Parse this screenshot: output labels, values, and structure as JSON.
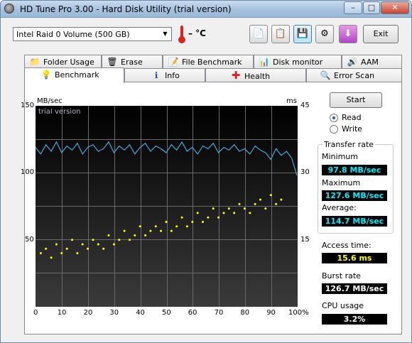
{
  "window": {
    "title": "HD Tune Pro 3.00 - Hard Disk Utility (trial version)"
  },
  "caption_buttons": {
    "minimize": "–",
    "maximize": "□",
    "close": "✕"
  },
  "toolbar": {
    "drive": "Intel   Raid 0 Volume (500 GB)",
    "temperature": "– °C",
    "exit_label": "Exit"
  },
  "tabs_top": [
    {
      "label": "Folder Usage",
      "icon": "folder-icon"
    },
    {
      "label": "Erase",
      "icon": "trash-icon"
    },
    {
      "label": "File Benchmark",
      "icon": "file-benchmark-icon"
    },
    {
      "label": "Disk monitor",
      "icon": "monitor-icon"
    },
    {
      "label": "AAM",
      "icon": "speaker-icon"
    }
  ],
  "tabs_bottom": [
    {
      "label": "Benchmark",
      "icon": "lightbulb-icon",
      "selected": true
    },
    {
      "label": "Info",
      "icon": "info-icon"
    },
    {
      "label": "Health",
      "icon": "health-cross-icon"
    },
    {
      "label": "Error Scan",
      "icon": "magnifier-icon"
    }
  ],
  "benchmark": {
    "start_label": "Start",
    "mode": {
      "read_label": "Read",
      "write_label": "Write",
      "selected": "read"
    },
    "transfer_rate_title": "Transfer rate",
    "minimum_label": "Minimum",
    "minimum_value": "97.8 MB/sec",
    "maximum_label": "Maximum",
    "maximum_value": "127.6 MB/sec",
    "average_label": "Average:",
    "average_value": "114.7 MB/sec",
    "access_time_label": "Access time:",
    "access_time_value": "15.6 ms",
    "burst_rate_label": "Burst rate",
    "burst_rate_value": "126.7 MB/sec",
    "cpu_usage_label": "CPU usage",
    "cpu_usage_value": "3.2%"
  },
  "chart_data": {
    "type": "line",
    "watermark": "trial version",
    "ylabel_left": "MB/sec",
    "ylabel_right": "ms",
    "yticks_left": [
      "150",
      "100",
      "50"
    ],
    "yticks_right": [
      "45",
      "30",
      "15"
    ],
    "xticks": [
      "0",
      "10",
      "20",
      "30",
      "40",
      "50",
      "60",
      "70",
      "80",
      "90",
      "100%"
    ],
    "xlim": [
      0,
      100
    ],
    "ylim_left": [
      0,
      150
    ],
    "ylim_right": [
      0,
      45
    ],
    "grid": true,
    "series": [
      {
        "kind": "transfer-rate-line",
        "color": "#3fa9e0",
        "axis": "left",
        "x": [
          0,
          2,
          4,
          6,
          8,
          10,
          12,
          14,
          16,
          18,
          20,
          22,
          24,
          26,
          28,
          30,
          32,
          34,
          36,
          38,
          40,
          42,
          44,
          46,
          48,
          50,
          52,
          54,
          56,
          58,
          60,
          62,
          64,
          66,
          68,
          70,
          72,
          74,
          76,
          78,
          80,
          82,
          84,
          86,
          88,
          90,
          92,
          94,
          96,
          98,
          100
        ],
        "y": [
          119,
          114,
          121,
          116,
          123,
          115,
          120,
          117,
          122,
          114,
          119,
          121,
          116,
          118,
          123,
          115,
          120,
          117,
          121,
          114,
          119,
          122,
          116,
          120,
          118,
          115,
          121,
          117,
          123,
          116,
          119,
          114,
          120,
          118,
          122,
          115,
          119,
          117,
          121,
          116,
          118,
          114,
          120,
          117,
          115,
          110,
          118,
          113,
          116,
          111,
          98
        ]
      },
      {
        "kind": "access-time-points",
        "color": "#ffff00",
        "axis": "right",
        "x": [
          2,
          4,
          6,
          8,
          10,
          12,
          14,
          16,
          18,
          20,
          22,
          24,
          26,
          28,
          30,
          32,
          34,
          36,
          38,
          40,
          42,
          44,
          46,
          48,
          50,
          52,
          54,
          56,
          58,
          60,
          62,
          64,
          66,
          68,
          70,
          72,
          74,
          76,
          78,
          80,
          82,
          84,
          86,
          88,
          90,
          92,
          94
        ],
        "y": [
          12,
          13,
          11,
          14,
          12,
          13,
          15,
          12,
          14,
          13,
          15,
          14,
          13,
          16,
          14,
          15,
          17,
          15,
          16,
          18,
          16,
          17,
          18,
          17,
          19,
          17,
          18,
          20,
          18,
          19,
          21,
          19,
          20,
          22,
          20,
          21,
          22,
          21,
          23,
          22,
          21,
          23,
          24,
          22,
          25,
          23,
          24
        ]
      }
    ]
  }
}
